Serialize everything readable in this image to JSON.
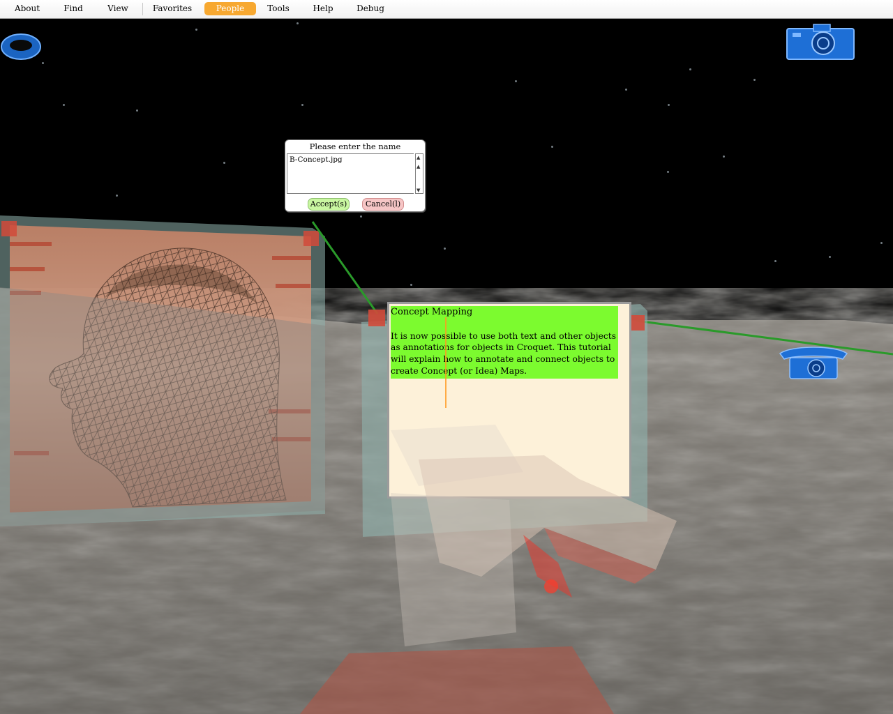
{
  "menubar": {
    "items": [
      {
        "label": "About"
      },
      {
        "label": "Find"
      },
      {
        "label": "View"
      },
      {
        "label": "Favorites"
      },
      {
        "label": "People"
      },
      {
        "label": "Tools"
      },
      {
        "label": "Help"
      },
      {
        "label": "Debug"
      }
    ],
    "active_item": "People"
  },
  "dialog": {
    "title": "Please enter the name",
    "input_value": "B-Concept.jpg",
    "accept_label": "Accept(s)",
    "cancel_label": "Cancel(l)"
  },
  "concept_panel": {
    "title": "Concept Mapping",
    "body": "It is now possible to use both text and other objects as annotations for objects in Croquet. This tutorial will explain how to annotate and connect objects to create Concept (or Idea) Maps."
  },
  "icons": {
    "top_left": "blue-ring-icon",
    "top_right": "camera-icon",
    "right": "telephone-icon",
    "center": "cursor-crosshair-icon"
  },
  "colors": {
    "menu_active": "#f7a830",
    "highlight_green": "#7cfb2f",
    "connector_green": "#2a9a2a",
    "accept_green": "#c9f7a1",
    "cancel_red": "#f6c6c6",
    "icon_blue": "#1e6fd6"
  }
}
